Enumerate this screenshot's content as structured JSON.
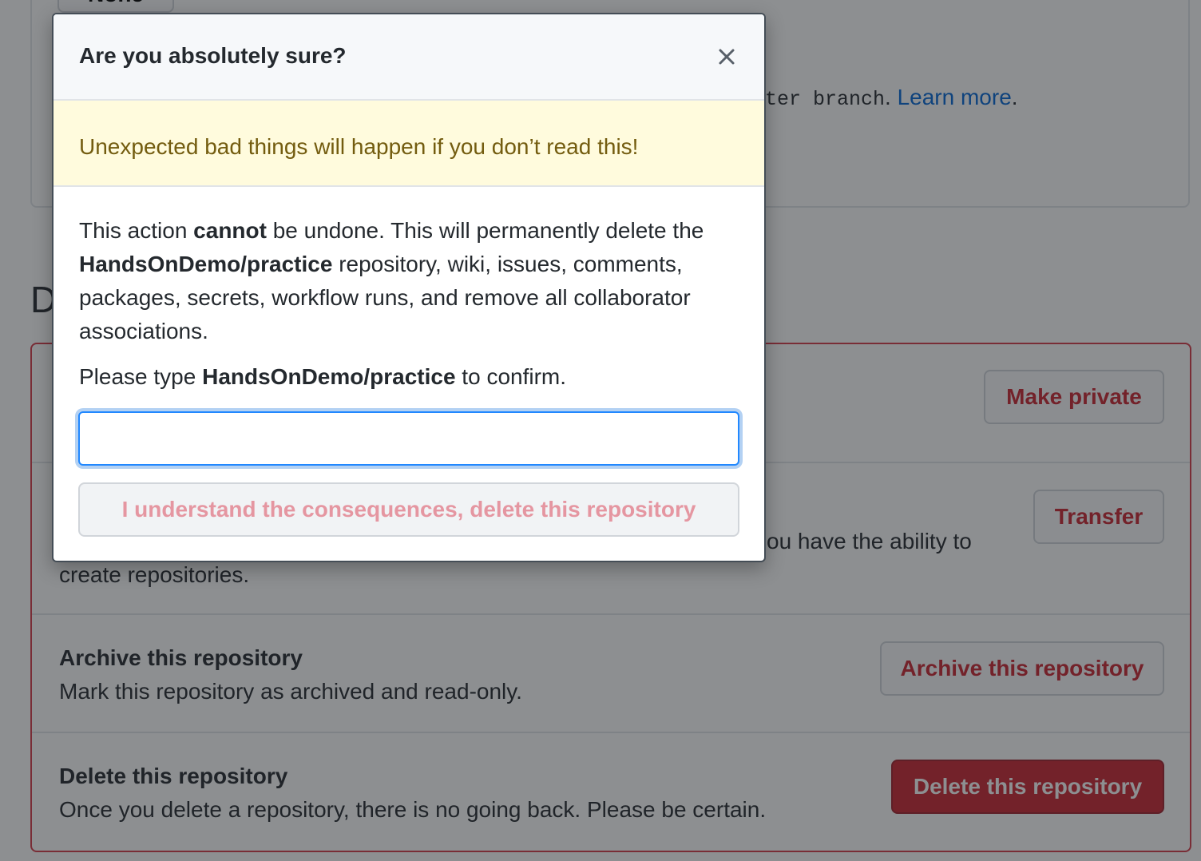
{
  "background": {
    "top_button_label": "None",
    "branch_text_mono": "ter branch",
    "branch_text_period": ".",
    "learn_more_link": "Learn more",
    "learn_more_period": ".",
    "danger_heading_visible": "D",
    "rows": [
      {
        "title": "",
        "desc": "",
        "button": "Make private"
      },
      {
        "title": "",
        "desc_line1": "ou have the ability to",
        "desc_line2": "create repositories.",
        "button": "Transfer"
      },
      {
        "title": "Archive this repository",
        "desc": "Mark this repository as archived and read-only.",
        "button": "Archive this repository"
      },
      {
        "title": "Delete this repository",
        "desc": "Once you delete a repository, there is no going back. Please be certain.",
        "button": "Delete this repository"
      }
    ]
  },
  "modal": {
    "title": "Are you absolutely sure?",
    "close_icon": "close-icon",
    "warning": "Unexpected bad things will happen if you don’t read this!",
    "body": {
      "part1": "This action ",
      "cannot": "cannot",
      "part2": " be undone. This will permanently delete the ",
      "repo": "HandsOnDemo/practice",
      "part3": " repository, wiki, issues, comments, packages, secrets, workflow runs, and remove all collaborator associations."
    },
    "confirm": {
      "prefix": "Please type ",
      "repo": "HandsOnDemo/practice",
      "suffix": " to confirm."
    },
    "input": {
      "value": "",
      "placeholder": ""
    },
    "confirm_button": "I understand the consequences, delete this repository"
  },
  "colors": {
    "danger": "#cb2431",
    "warning_bg": "#fffbdd",
    "warning_text": "#735c0f",
    "link": "#0366d6",
    "focus": "#2188ff"
  }
}
